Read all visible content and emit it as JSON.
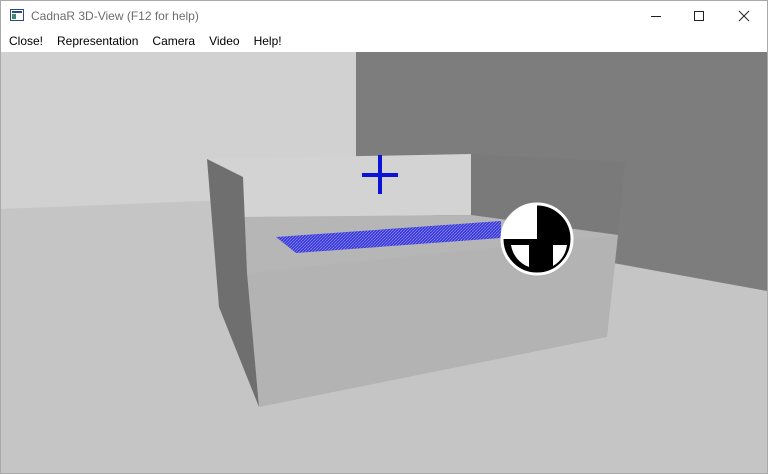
{
  "window": {
    "title": "CadnaR 3D-View (F12 for help)"
  },
  "menu": {
    "items": [
      "Close!",
      "Representation",
      "Camera",
      "Video",
      "Help!"
    ]
  },
  "scene": {
    "source_marker": "blue-crosshair",
    "receiver_area": "blue-hatched-plane",
    "object": "black-white-sphere",
    "colors": {
      "source_blue": "#0b14d6",
      "area_blue": "#3b3bd8",
      "floor": "#c5c5c5",
      "wall_left": "#d1d1d1",
      "wall_right": "#7a7a7a"
    }
  }
}
